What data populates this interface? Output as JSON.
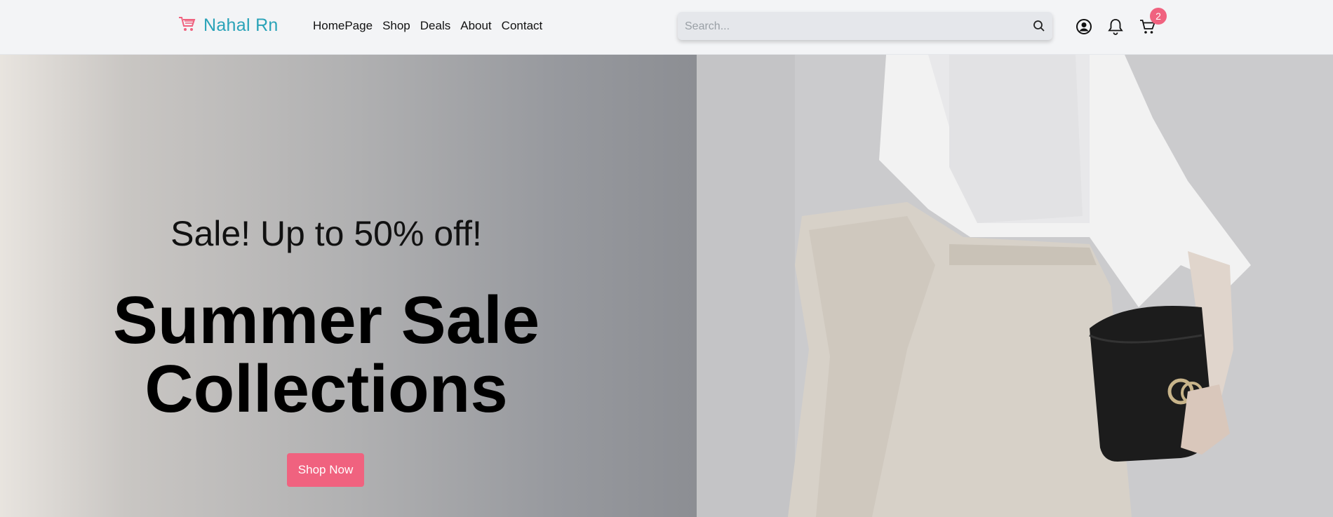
{
  "brand": {
    "name": "Nahal Rn",
    "accent": "#2aa3b8",
    "cart_color": "#f0627f"
  },
  "nav": {
    "items": [
      "HomePage",
      "Shop",
      "Deals",
      "About",
      "Contact"
    ]
  },
  "search": {
    "placeholder": "Search..."
  },
  "header_icons": {
    "user": "user-circle-icon",
    "bell": "bell-icon",
    "cart": "cart-icon",
    "cart_count": "2"
  },
  "hero": {
    "subtitle": "Sale! Up to 50% off!",
    "title_line1": "Summer Sale",
    "title_line2": "Collections",
    "cta_label": "Shop Now",
    "cta_color": "#f0627f"
  }
}
